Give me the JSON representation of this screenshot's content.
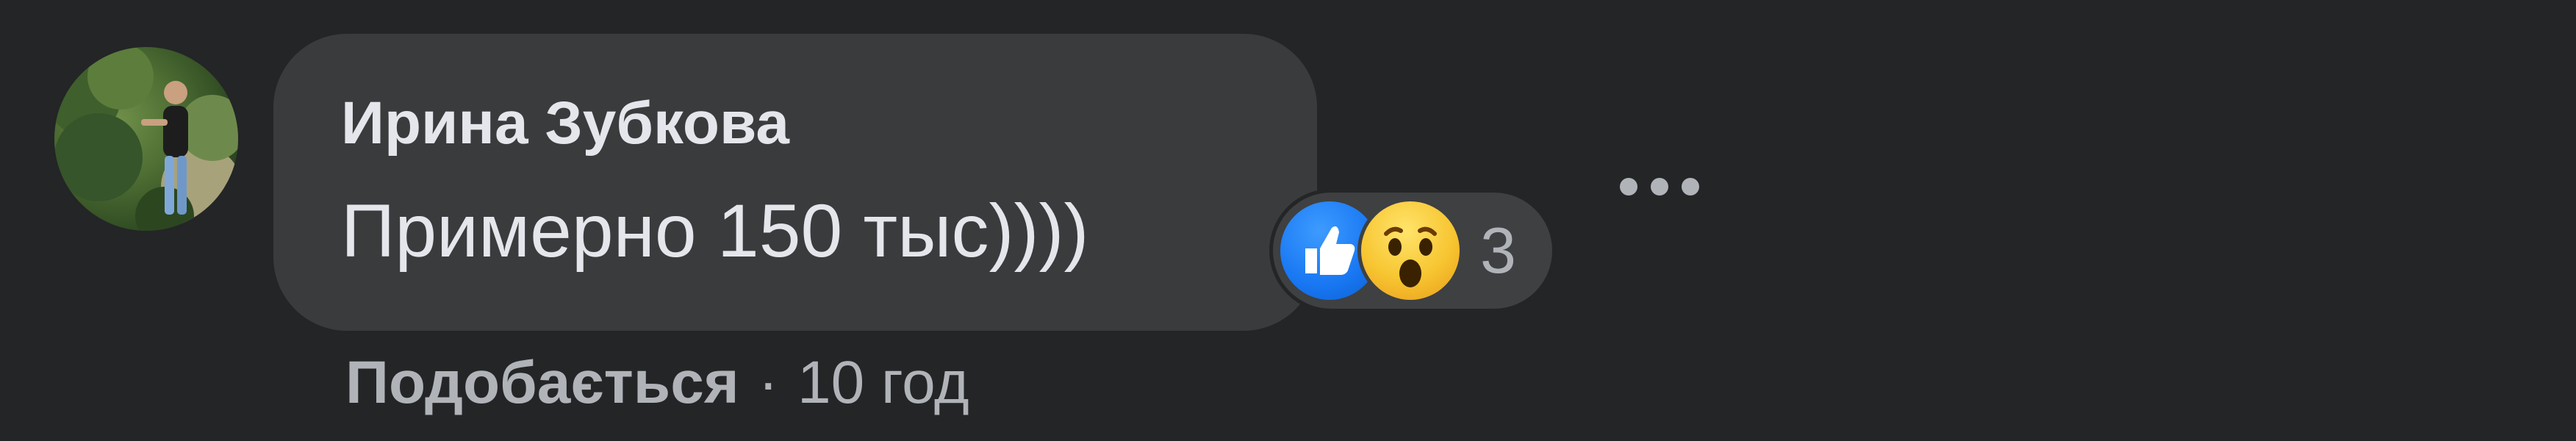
{
  "comment": {
    "author": "Ирина Зубкова",
    "text": "Примерно 150 тыс))))"
  },
  "reactions": {
    "icons": [
      "like-icon",
      "wow-icon"
    ],
    "count": "3"
  },
  "actions": {
    "like_label": "Подобається",
    "separator": "·",
    "timestamp": "10 год"
  },
  "menu": {
    "icon": "more-options-icon"
  },
  "colors": {
    "background": "#242526",
    "bubble": "#3a3b3c",
    "primary_text": "#e4e6eb",
    "secondary_text": "#b0b3b8",
    "like_blue": "#1877f2",
    "wow_yellow": "#f7c531"
  }
}
